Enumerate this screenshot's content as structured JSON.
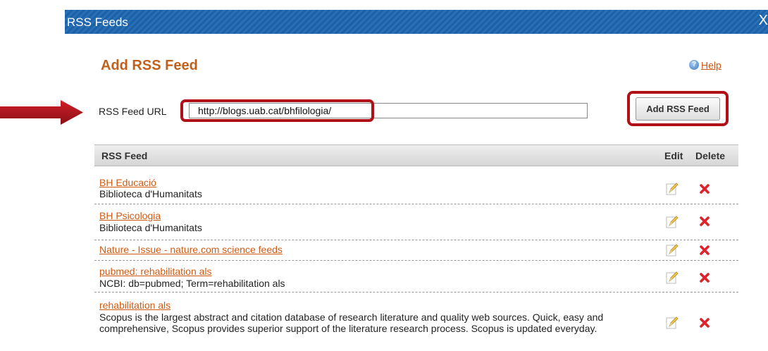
{
  "dialog": {
    "title": "RSS Feeds",
    "close_label": "X"
  },
  "heading": "Add RSS Feed",
  "help": {
    "label": "Help"
  },
  "form": {
    "url_label": "RSS Feed URL",
    "url_value": "http://blogs.uab.cat/bhfilologia/",
    "add_button_label": "Add RSS Feed"
  },
  "table": {
    "headers": {
      "feed": "RSS Feed",
      "edit": "Edit",
      "delete": "Delete"
    },
    "rows": [
      {
        "title": "BH Educació",
        "description": "Biblioteca d'Humanitats"
      },
      {
        "title": "BH Psicologia",
        "description": "Biblioteca d'Humanitats"
      },
      {
        "title": "Nature - Issue - nature.com science feeds",
        "description": ""
      },
      {
        "title": "pubmed: rehabilitation als",
        "description": "NCBI: db=pubmed; Term=rehabilitation als"
      },
      {
        "title": "rehabilitation als",
        "description": "Scopus is the largest abstract and citation database of research literature and quality web sources. Quick, easy and comprehensive, Scopus provides superior support of the literature research process. Scopus is updated everyday."
      }
    ]
  },
  "colors": {
    "accent": "#c1601a",
    "link": "#d05a12",
    "highlight": "#b01018",
    "titlebar": "#1c62a8"
  },
  "icons": {
    "help": "help-circle-icon",
    "edit": "pencil-icon",
    "delete": "red-x-icon",
    "arrow": "arrow-right-icon"
  }
}
